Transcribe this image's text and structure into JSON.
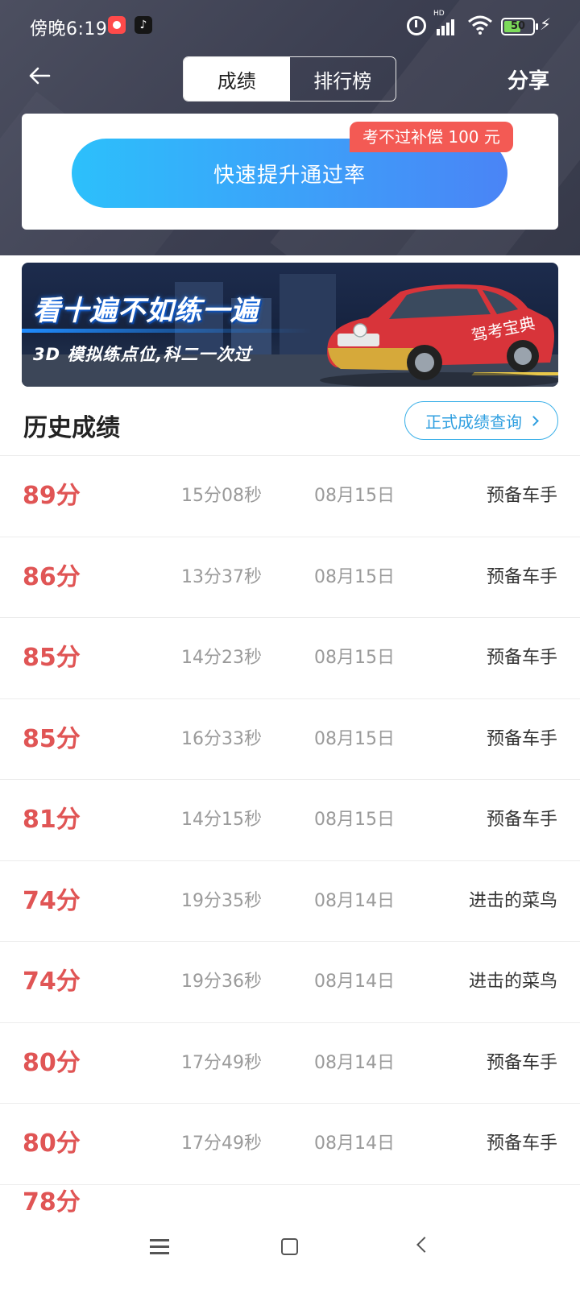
{
  "status_bar": {
    "time": "傍晚6:19",
    "tiktok_glyph": "♪",
    "hd_label": "HD",
    "battery_level": "50",
    "icons": [
      "notification-app-icon",
      "tiktok-icon",
      "alarm-icon",
      "signal-icon",
      "wifi-icon",
      "battery-icon",
      "charging-icon"
    ]
  },
  "nav": {
    "tabs": [
      {
        "label": "成绩",
        "active": true
      },
      {
        "label": "排行榜",
        "active": false
      }
    ],
    "share_label": "分享"
  },
  "promo": {
    "button_label": "快速提升通过率",
    "badge_text": "考不过补偿 100 元"
  },
  "banner": {
    "headline": "看十遍不如练一遍",
    "subline": "3D 模拟练点位,科二一次过",
    "car_text": "驾考宝典"
  },
  "history": {
    "title": "历史成绩",
    "official_query_label": "正式成绩查询",
    "rows": [
      {
        "score": "89分",
        "duration": "15分08秒",
        "date": "08月15日",
        "title": "预备车手"
      },
      {
        "score": "86分",
        "duration": "13分37秒",
        "date": "08月15日",
        "title": "预备车手"
      },
      {
        "score": "85分",
        "duration": "14分23秒",
        "date": "08月15日",
        "title": "预备车手"
      },
      {
        "score": "85分",
        "duration": "16分33秒",
        "date": "08月15日",
        "title": "预备车手"
      },
      {
        "score": "81分",
        "duration": "14分15秒",
        "date": "08月15日",
        "title": "预备车手"
      },
      {
        "score": "74分",
        "duration": "19分35秒",
        "date": "08月14日",
        "title": "进击的菜鸟"
      },
      {
        "score": "74分",
        "duration": "19分36秒",
        "date": "08月14日",
        "title": "进击的菜鸟"
      },
      {
        "score": "80分",
        "duration": "17分49秒",
        "date": "08月14日",
        "title": "预备车手"
      },
      {
        "score": "80分",
        "duration": "17分49秒",
        "date": "08月14日",
        "title": "预备车手"
      }
    ],
    "partial_row_score": "78分"
  },
  "colors": {
    "score_red": "#e05555",
    "header_dark": "#3d4052",
    "promo_blue": "#3d9ff9",
    "badge_red": "#f35a54",
    "link_blue": "#2f9fe0"
  }
}
